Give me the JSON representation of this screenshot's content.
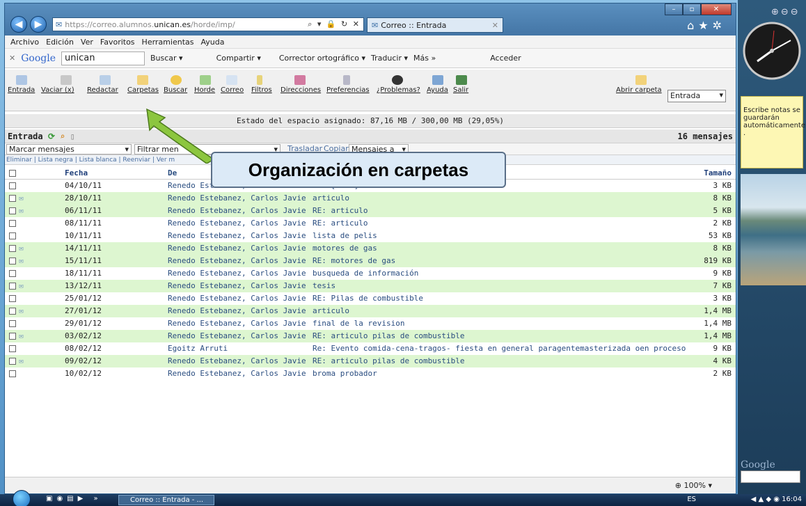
{
  "window": {
    "url_prefix": "https://correo.alumnos.",
    "url_domain": "unican.es",
    "url_suffix": "/horde/imp/",
    "tab_title": "Correo :: Entrada"
  },
  "menubar": [
    "Archivo",
    "Edición",
    "Ver",
    "Favoritos",
    "Herramientas",
    "Ayuda"
  ],
  "googlebar": {
    "brand": "Google",
    "query": "unican",
    "items": [
      "Buscar ▾",
      "Compartir ▾",
      "Corrector ortográfico ▾",
      "Traducir ▾",
      "Más »"
    ],
    "acceder": "Acceder"
  },
  "horde_toolbar": {
    "buttons": [
      "Entrada",
      "Vaciar (x)",
      "Redactar",
      "Carpetas",
      "Buscar",
      "Horde",
      "Correo",
      "Filtros",
      "Direcciones",
      "Preferencias",
      "¿Problemas?",
      "Ayuda",
      "Salir"
    ],
    "open_folder": "Abrir carpeta",
    "folder_select": "Entrada"
  },
  "quota": "Estado del espacio asignado: 87,16 MB / 300,00 MB (29,05%)",
  "folder": {
    "name": "Entrada",
    "count": "16 mensajes"
  },
  "actions": {
    "mark": "Marcar mensajes",
    "filter": "Filtrar men",
    "move": "Trasladar",
    "copy": "Copiar",
    "target": "Mensajes a",
    "links": "Eliminar | Lista negra | Lista blanca | Reenviar | Ver m"
  },
  "table": {
    "headers": {
      "date": "Fecha",
      "from": "De",
      "size": "Tamaño"
    },
    "rows": [
      {
        "date": "04/10/11",
        "from": "Renedo Estebanez, Carlos Javier",
        "subject": "RV: [DYNA] Envío recibido",
        "size": "3 KB",
        "icon": false,
        "alt": false
      },
      {
        "date": "28/10/11",
        "from": "Renedo Estebanez, Carlos Javier",
        "subject": "articulo",
        "size": "8 KB",
        "icon": true,
        "alt": true
      },
      {
        "date": "06/11/11",
        "from": "Renedo Estebanez, Carlos Javier",
        "subject": "RE: articulo",
        "size": "5 KB",
        "icon": true,
        "alt": true
      },
      {
        "date": "08/11/11",
        "from": "Renedo Estebanez, Carlos Javier",
        "subject": "RE: articulo",
        "size": "2 KB",
        "icon": false,
        "alt": false
      },
      {
        "date": "10/11/11",
        "from": "Renedo Estebanez, Carlos Javier",
        "subject": "lista de pelis",
        "size": "53 KB",
        "icon": false,
        "alt": false
      },
      {
        "date": "14/11/11",
        "from": "Renedo Estebanez, Carlos Javier",
        "subject": "motores de gas",
        "size": "8 KB",
        "icon": true,
        "alt": true
      },
      {
        "date": "15/11/11",
        "from": "Renedo Estebanez, Carlos Javier",
        "subject": "RE: motores de gas",
        "size": "819 KB",
        "icon": true,
        "alt": true
      },
      {
        "date": "18/11/11",
        "from": "Renedo Estebanez, Carlos Javier",
        "subject": "busqueda de información",
        "size": "9 KB",
        "icon": false,
        "alt": false
      },
      {
        "date": "13/12/11",
        "from": "Renedo Estebanez, Carlos Javier",
        "subject": "tesis",
        "size": "7 KB",
        "icon": true,
        "alt": true
      },
      {
        "date": "25/01/12",
        "from": "Renedo Estebanez, Carlos Javier",
        "subject": "RE: Pilas de combustible",
        "size": "3 KB",
        "icon": false,
        "alt": false
      },
      {
        "date": "27/01/12",
        "from": "Renedo Estebanez, Carlos Javier",
        "subject": "articulo",
        "size": "1,4 MB",
        "icon": true,
        "alt": true
      },
      {
        "date": "29/01/12",
        "from": "Renedo Estebanez, Carlos Javier",
        "subject": "final de la revision",
        "size": "1,4 MB",
        "icon": false,
        "alt": false
      },
      {
        "date": "03/02/12",
        "from": "Renedo Estebanez, Carlos Javier",
        "subject": "RE: articulo pilas de combustible",
        "size": "1,4 MB",
        "icon": true,
        "alt": true
      },
      {
        "date": "08/02/12",
        "from": "Egoitz Arruti",
        "subject": "Re: Evento comida-cena-tragos- fiesta en general paragentemasterizada oen proceso de ello",
        "size": "9 KB",
        "icon": false,
        "alt": false
      },
      {
        "date": "09/02/12",
        "from": "Renedo Estebanez, Carlos Javier",
        "subject": "RE: articulo pilas de combustible",
        "size": "4 KB",
        "icon": true,
        "alt": true
      },
      {
        "date": "10/02/12",
        "from": "Renedo Estebanez, Carlos Javier",
        "subject": "broma probador",
        "size": "2 KB",
        "icon": false,
        "alt": false
      }
    ]
  },
  "callout": "Organización en carpetas",
  "statusbar": {
    "zoom": "100%"
  },
  "sidebar": {
    "note": "Escribe notas se guardarán automáticamente .",
    "google": "Google"
  },
  "taskbar": {
    "task": "Correo :: Entrada - ...",
    "lang": "ES",
    "time": "16:04"
  },
  "colors": {
    "row_alt": "#ddf6d0",
    "callout_bg": "#dceaf7",
    "arrow": "#8cc63f"
  },
  "icons": [
    "back-icon",
    "forward-icon",
    "home-icon",
    "star-icon",
    "gear-icon",
    "mail-icon",
    "clock-icon"
  ]
}
